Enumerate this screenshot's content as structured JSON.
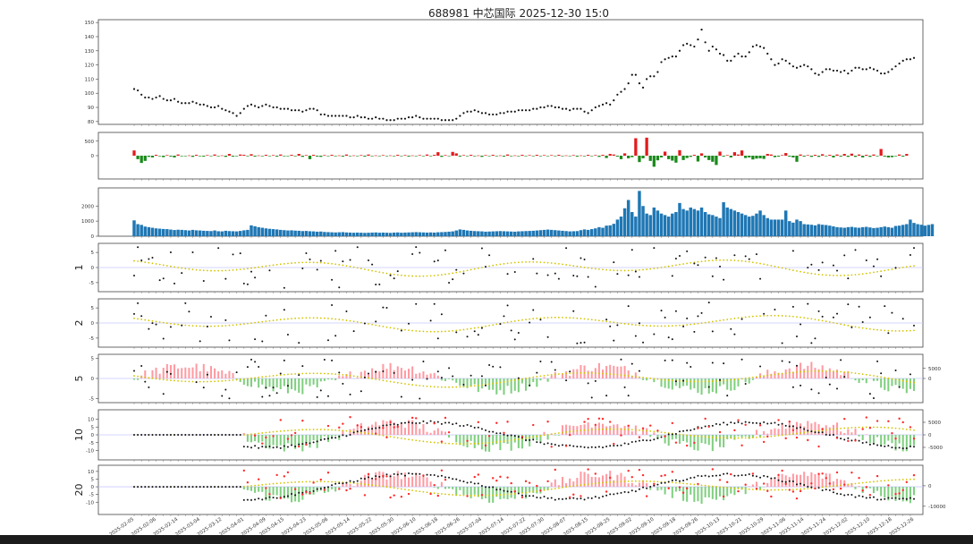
{
  "title": "688981 中芯国际 2025-12-30 15:0",
  "chart_data": [
    {
      "type": "scatter",
      "name": "price",
      "ylim": [
        78,
        152
      ],
      "yticks": [
        "80",
        "90",
        "100",
        "110",
        "120",
        "130",
        "140",
        "150"
      ],
      "ytick_values": [
        80,
        90,
        100,
        110,
        120,
        130,
        140,
        150
      ],
      "points": [
        103,
        102,
        99,
        97,
        97,
        96,
        97,
        98,
        96,
        95,
        95,
        96,
        94,
        93,
        93,
        93,
        94,
        93,
        92,
        92,
        91,
        90,
        90,
        91,
        89,
        88,
        87,
        86,
        84,
        86,
        89,
        91,
        92,
        91,
        90,
        91,
        92,
        91,
        90,
        90,
        89,
        89,
        89,
        88,
        88,
        88,
        87,
        88,
        89,
        89,
        88,
        85,
        85,
        84,
        84,
        84,
        84,
        84,
        84,
        83,
        83,
        84,
        83,
        83,
        82,
        82,
        83,
        82,
        82,
        81,
        81,
        81,
        82,
        82,
        82,
        83,
        83,
        84,
        83,
        82,
        82,
        82,
        82,
        82,
        81,
        81,
        81,
        81,
        82,
        84,
        86,
        87,
        87,
        88,
        87,
        86,
        86,
        85,
        85,
        85,
        86,
        86,
        87,
        87,
        87,
        88,
        88,
        88,
        88,
        89,
        89,
        90,
        90,
        91,
        91,
        90,
        90,
        89,
        89,
        88,
        89,
        89,
        89,
        87,
        86,
        88,
        90,
        91,
        92,
        93,
        92,
        95,
        99,
        101,
        103,
        107,
        113,
        113,
        107,
        104,
        110,
        112,
        112,
        115,
        122,
        124,
        125,
        126,
        126,
        130,
        134,
        135,
        134,
        133,
        138,
        145,
        136,
        130,
        133,
        131,
        128,
        127,
        123,
        123,
        126,
        128,
        126,
        126,
        129,
        133,
        134,
        133,
        132,
        128,
        124,
        120,
        121,
        124,
        123,
        121,
        119,
        118,
        119,
        120,
        119,
        117,
        114,
        113,
        115,
        117,
        117,
        116,
        116,
        115,
        116,
        114,
        116,
        118,
        118,
        117,
        117,
        118,
        117,
        116,
        114,
        114,
        115,
        117,
        119,
        121,
        123,
        124,
        124,
        125
      ]
    },
    {
      "type": "bar",
      "name": "volume_change",
      "ylim": [
        -800,
        800
      ],
      "yticks": [
        "500",
        "0"
      ],
      "ytick_values": [
        500,
        0
      ],
      "colors": {
        "up": "#e31a1c",
        "down": "#1a8a1a"
      },
      "values": [
        180,
        -120,
        -250,
        -180,
        -40,
        -60,
        30,
        -20,
        -50,
        20,
        -30,
        -60,
        40,
        -20,
        -10,
        10,
        -40,
        30,
        -20,
        -30,
        20,
        -10,
        40,
        -20,
        10,
        -40,
        60,
        -30,
        -10,
        40,
        30,
        -20,
        50,
        -30,
        10,
        -20,
        30,
        -10,
        20,
        -30,
        40,
        -20,
        -10,
        30,
        -20,
        60,
        -40,
        20,
        -120,
        30,
        -30,
        -40,
        20,
        -10,
        30,
        -20,
        10,
        -30,
        40,
        -20,
        10,
        -10,
        20,
        -30,
        40,
        -20,
        10,
        -10,
        20,
        -10,
        10,
        -20,
        30,
        -10,
        20,
        -30,
        10,
        -10,
        20,
        -10,
        40,
        -20,
        30,
        120,
        -40,
        20,
        -10,
        130,
        80,
        -30,
        20,
        -10,
        30,
        -20,
        10,
        -40,
        20,
        -10,
        30,
        -20,
        10,
        -30,
        40,
        -20,
        10,
        -20,
        30,
        -10,
        20,
        -10,
        30,
        -20,
        20,
        -10,
        20,
        -10,
        30,
        -20,
        10,
        -10,
        20,
        -30,
        10,
        -20,
        30,
        -10,
        20,
        -40,
        30,
        -80,
        60,
        40,
        -30,
        -120,
        80,
        -90,
        -50,
        600,
        -220,
        -90,
        620,
        -180,
        -380,
        -160,
        -60,
        140,
        -120,
        -170,
        -240,
        190,
        -150,
        -80,
        -40,
        30,
        -200,
        80,
        -60,
        -150,
        -210,
        -320,
        140,
        -30,
        20,
        -60,
        120,
        40,
        180,
        -80,
        -60,
        -130,
        -100,
        -90,
        -110,
        60,
        40,
        -50,
        -30,
        20,
        90,
        -30,
        -60,
        -210,
        40,
        -30,
        20,
        -40,
        30,
        -40,
        50,
        -20,
        30,
        -60,
        40,
        -30,
        60,
        -40,
        70,
        -40,
        40,
        -60,
        30,
        -40,
        40,
        -20,
        230,
        -30,
        -60,
        -50,
        -20,
        40,
        -30,
        60
      ]
    },
    {
      "type": "bar",
      "name": "volume",
      "ylim": [
        0,
        3200
      ],
      "yticks": [
        "2000",
        "1000",
        "0"
      ],
      "ytick_values": [
        2000,
        1000,
        0
      ],
      "color": "#1f77b4",
      "values": [
        1050,
        800,
        750,
        640,
        600,
        560,
        520,
        500,
        480,
        470,
        440,
        410,
        430,
        420,
        400,
        380,
        420,
        390,
        380,
        360,
        350,
        340,
        380,
        330,
        320,
        360,
        340,
        330,
        320,
        350,
        390,
        420,
        720,
        660,
        600,
        560,
        520,
        490,
        470,
        450,
        420,
        400,
        380,
        390,
        370,
        360,
        340,
        350,
        330,
        320,
        300,
        310,
        280,
        270,
        260,
        250,
        260,
        270,
        250,
        240,
        230,
        240,
        230,
        220,
        230,
        240,
        250,
        230,
        240,
        230,
        220,
        240,
        250,
        230,
        240,
        250,
        260,
        270,
        260,
        250,
        240,
        250,
        240,
        260,
        270,
        280,
        300,
        320,
        380,
        450,
        420,
        380,
        360,
        340,
        330,
        320,
        300,
        310,
        320,
        330,
        340,
        330,
        320,
        310,
        300,
        320,
        330,
        340,
        350,
        360,
        380,
        400,
        420,
        440,
        420,
        400,
        380,
        360,
        340,
        320,
        330,
        340,
        400,
        450,
        420,
        470,
        520,
        600,
        560,
        700,
        720,
        820,
        1100,
        1300,
        1850,
        2400,
        1600,
        1300,
        3000,
        2000,
        1500,
        1400,
        1900,
        1700,
        1500,
        1400,
        1300,
        1500,
        1600,
        2200,
        1800,
        1700,
        1900,
        1800,
        1700,
        1900,
        1600,
        1450,
        1400,
        1300,
        1200,
        2250,
        1900,
        1800,
        1700,
        1600,
        1500,
        1400,
        1300,
        1350,
        1500,
        1700,
        1400,
        1200,
        1100,
        1100,
        1100,
        1100,
        1700,
        1000,
        900,
        1100,
        1000,
        800,
        780,
        760,
        720,
        800,
        760,
        740,
        700,
        650,
        600,
        580,
        560,
        600,
        620,
        580,
        560,
        600,
        620,
        580,
        540,
        560,
        600,
        640,
        600,
        560,
        680,
        700,
        750,
        800,
        1100,
        880,
        800,
        760,
        700,
        750,
        800
      ]
    },
    {
      "type": "scatter",
      "name": "indicator_1",
      "ylabel": "1",
      "ylim": [
        -8,
        8
      ],
      "yticks": [
        "5",
        "0",
        "-5"
      ],
      "ytick_values": [
        5,
        0,
        -5
      ]
    },
    {
      "type": "scatter",
      "name": "indicator_2",
      "ylabel": "2",
      "ylim": [
        -8,
        8
      ],
      "yticks": [
        "5",
        "0",
        "-5"
      ],
      "ytick_values": [
        5,
        0,
        -5
      ]
    },
    {
      "type": "scatter",
      "name": "indicator_5",
      "ylabel": "5",
      "ylim": [
        -6,
        6
      ],
      "yticks": [
        "5",
        "0",
        "-5"
      ],
      "ytick_values": [
        5,
        0,
        -5
      ],
      "y2ticks": [
        "5000",
        "0"
      ],
      "y2tick_values": [
        5000,
        0
      ],
      "y2lim": [
        -12000,
        12000
      ]
    },
    {
      "type": "scatter",
      "name": "indicator_10",
      "ylabel": "10",
      "ylim": [
        -16,
        16
      ],
      "yticks": [
        "10",
        "5",
        "0",
        "-5",
        "-10"
      ],
      "ytick_values": [
        10,
        5,
        0,
        -5,
        -10
      ],
      "y2ticks": [
        "5000",
        "0",
        "-5000"
      ],
      "y2tick_values": [
        5000,
        0,
        -5000
      ],
      "y2lim": [
        -10000,
        10000
      ]
    },
    {
      "type": "scatter",
      "name": "indicator_20",
      "ylabel": "20",
      "ylim": [
        -18,
        14
      ],
      "yticks": [
        "10",
        "5",
        "0",
        "-5",
        "-10"
      ],
      "ytick_values": [
        10,
        5,
        0,
        -5,
        -10
      ],
      "y2ticks": [
        "0",
        "-10000"
      ],
      "y2tick_values": [
        0,
        -10000
      ],
      "y2lim": [
        -14000,
        10000
      ]
    }
  ],
  "x_axis": {
    "tick_labels": [
      "2025-02-05",
      "2025-02-06",
      "2025-02-14",
      "2025-03-04",
      "2025-03-12",
      "2025-04-01",
      "2025-04-09",
      "2025-04-15",
      "2025-04-23",
      "2025-05-06",
      "2025-05-14",
      "2025-05-22",
      "2025-05-30",
      "2025-06-10",
      "2025-06-18",
      "2025-06-26",
      "2025-07-04",
      "2025-07-14",
      "2025-07-22",
      "2025-07-30",
      "2025-08-07",
      "2025-08-15",
      "2025-08-25",
      "2025-09-02",
      "2025-09-10",
      "2025-09-18",
      "2025-09-26",
      "2025-10-13",
      "2025-10-21",
      "2025-10-29",
      "2025-11-06",
      "2025-11-14",
      "2025-11-24",
      "2025-12-02",
      "2025-12-10",
      "2025-12-18",
      "2025-12-26"
    ]
  },
  "colors": {
    "black_points": "#111111",
    "yellow_points": "#d4c400",
    "red_points": "#ff2b2b",
    "pink_bars": "#ff9aa2",
    "green_bars": "#7fcf7f",
    "zero_line": "#c8c8ff",
    "axis": "#333333"
  }
}
